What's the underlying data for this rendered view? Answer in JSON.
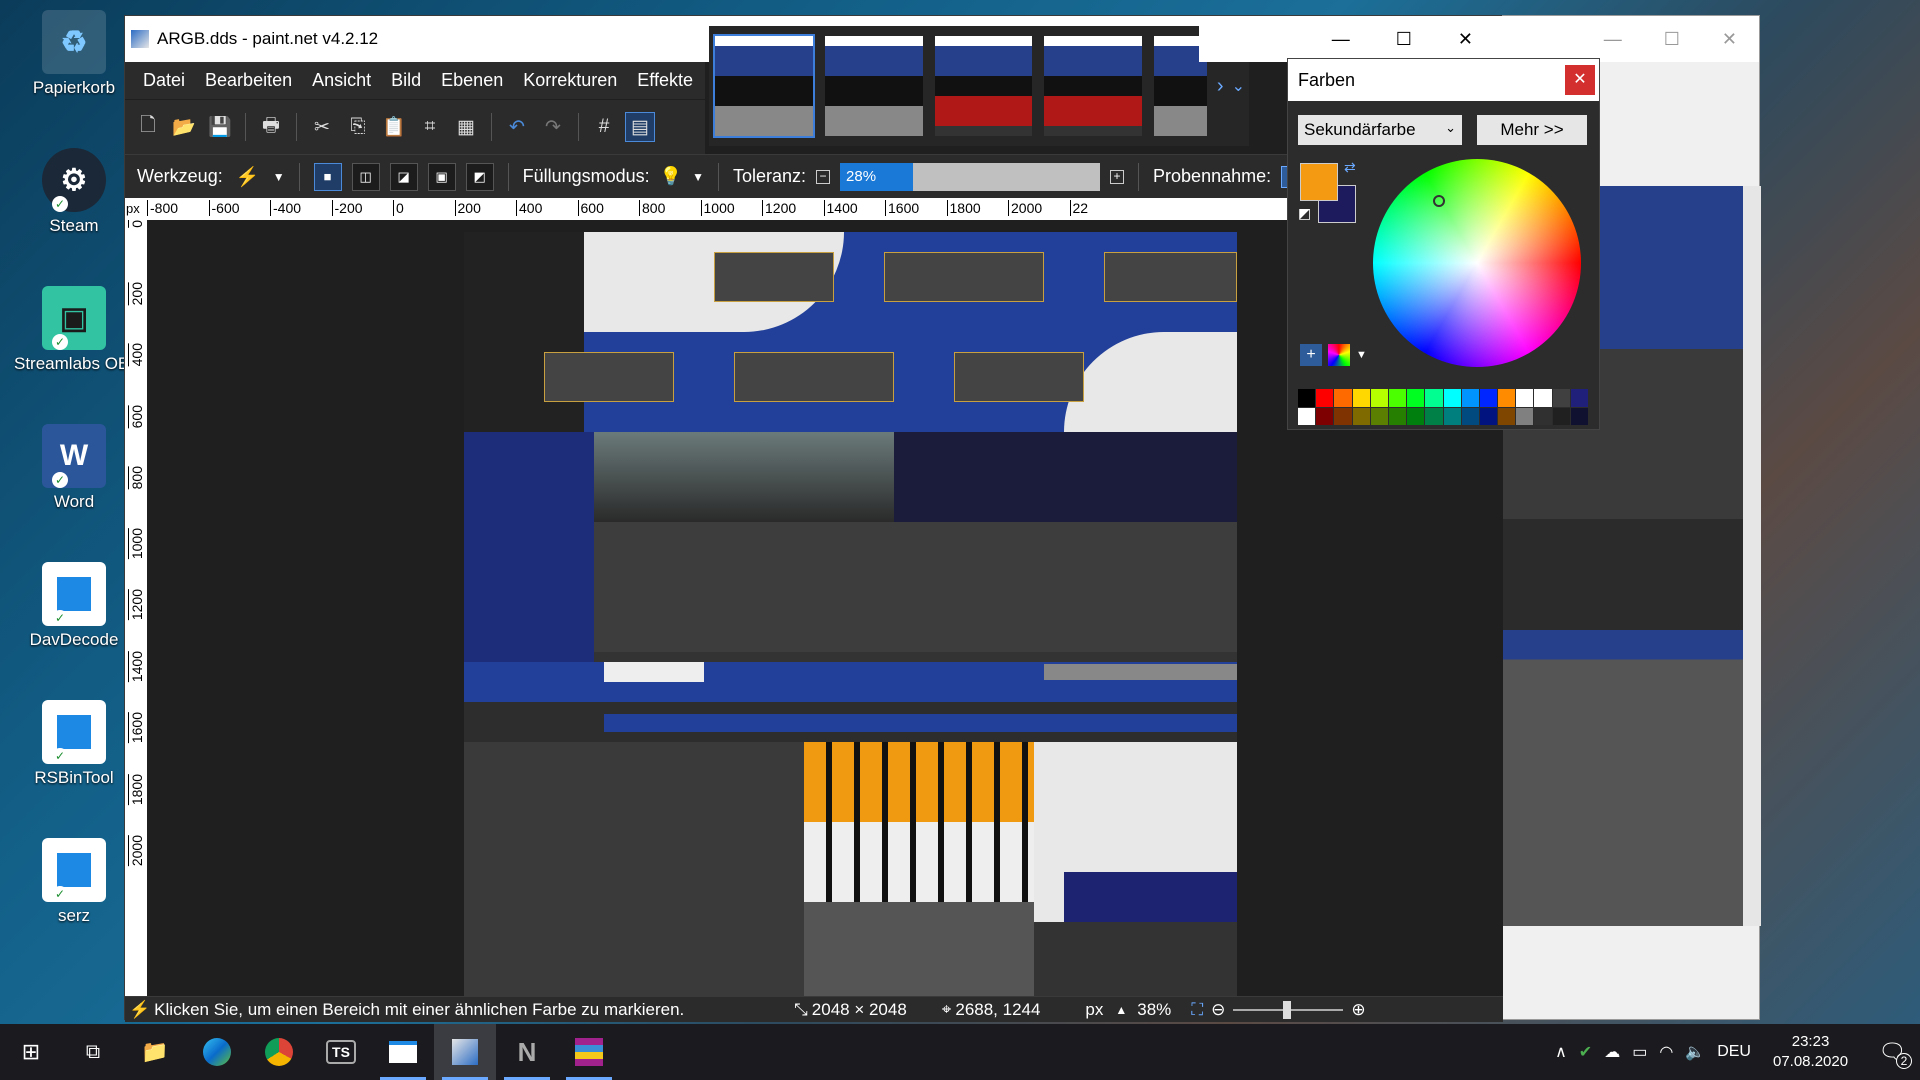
{
  "desktop": {
    "icons": [
      {
        "label": "Papierkorb",
        "icon": "recycle-bin-icon"
      },
      {
        "label": "Steam",
        "icon": "steam-icon"
      },
      {
        "label": "Streamlabs OBS",
        "icon": "streamlabs-icon"
      },
      {
        "label": "Word",
        "icon": "word-icon"
      },
      {
        "label": "DavDecode",
        "icon": "app-icon"
      },
      {
        "label": "RSBinTool",
        "icon": "app-icon"
      },
      {
        "label": "serz",
        "icon": "app-icon"
      }
    ]
  },
  "window": {
    "title": "ARGB.dds - paint.net v4.2.12",
    "menu": [
      "Datei",
      "Bearbeiten",
      "Ansicht",
      "Bild",
      "Ebenen",
      "Korrekturen",
      "Effekte"
    ]
  },
  "toolbar": {
    "tool_label": "Werkzeug:",
    "fill_mode_label": "Füllungsmodus:",
    "tolerance_label": "Toleranz:",
    "tolerance_value": "28%",
    "tolerance_fraction": 0.28,
    "sampling_label": "Probennahme:"
  },
  "ruler": {
    "unit": "px",
    "top_ticks": [
      "-800",
      "-600",
      "-400",
      "-200",
      "0",
      "200",
      "400",
      "600",
      "800",
      "1000",
      "1200",
      "1400",
      "1600",
      "1800",
      "2000",
      "22"
    ],
    "left_ticks": [
      "0",
      "200",
      "400",
      "600",
      "800",
      "1000",
      "1200",
      "1400",
      "1600",
      "1800",
      "2000"
    ]
  },
  "status": {
    "hint": "Klicken Sie, um einen Bereich mit einer ähnlichen Farbe zu markieren.",
    "image_size": "2048 × 2048",
    "cursor_pos": "2688, 1244",
    "unit": "px",
    "zoom": "38%"
  },
  "colors_panel": {
    "title": "Farben",
    "mode": "Sekundärfarbe",
    "more_button": "Mehr >>",
    "primary_color": "#f39a12",
    "secondary_color": "#1d1b5e",
    "palette": [
      "#000000",
      "#ff0000",
      "#ff6a00",
      "#ffd800",
      "#b6ff00",
      "#4cff00",
      "#00ff21",
      "#00ff90",
      "#00ffff",
      "#0094ff",
      "#0026ff",
      "#ff8c00",
      "#ffffff",
      "#ffffff",
      "#404040",
      "#20207a",
      "#ffffff",
      "#7f0000",
      "#7f3300",
      "#7f6a00",
      "#5b7f00",
      "#267f00",
      "#007f0e",
      "#007f46",
      "#007f7f",
      "#004a7f",
      "#00137f",
      "#7f4600",
      "#808080",
      "#303030",
      "#202020",
      "#101030"
    ]
  },
  "taskbar": {
    "apps": [
      "start-icon",
      "task-view-icon",
      "explorer-icon",
      "edge-icon",
      "chrome-icon",
      "ts-icon",
      "app-window-icon",
      "paintnet-icon",
      "n-icon",
      "winrar-icon"
    ],
    "lang": "DEU",
    "time": "23:23",
    "date": "07.08.2020",
    "notifications": "2"
  }
}
